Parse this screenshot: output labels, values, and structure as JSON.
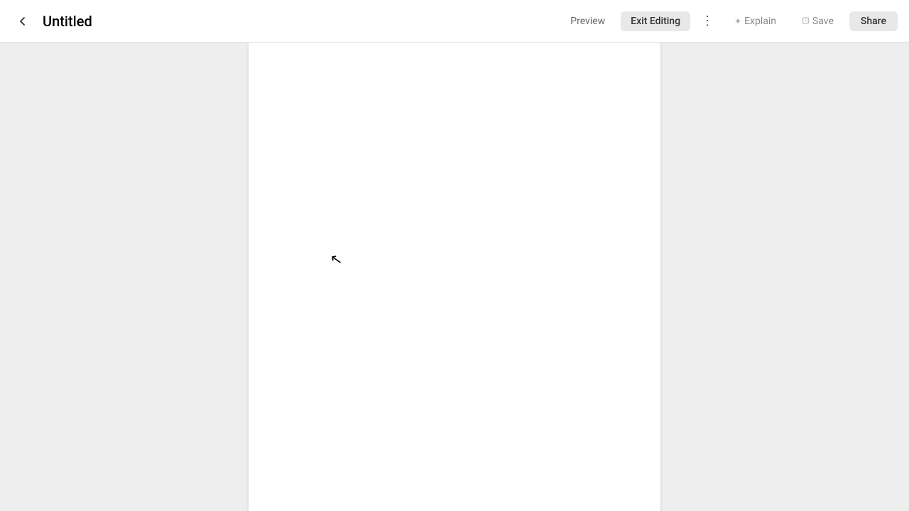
{
  "header": {
    "title": "Untitled",
    "back_label": "←",
    "preview_label": "Preview",
    "exit_editing_label": "Exit Editing",
    "more_label": "⋮",
    "explain_label": "Explain",
    "save_label": "Save",
    "share_label": "Share"
  },
  "colors": {
    "background": "#eeeeee",
    "header_bg": "#ffffff",
    "document_bg": "#ffffff",
    "border": "#e0e0e0",
    "button_bg": "#e8e8e8",
    "text_primary": "#000000",
    "text_secondary": "#666666",
    "text_muted": "#888888"
  },
  "icons": {
    "back": "‹",
    "explain_spark": "✦",
    "save_disk": "⊡",
    "more": "⋮"
  }
}
